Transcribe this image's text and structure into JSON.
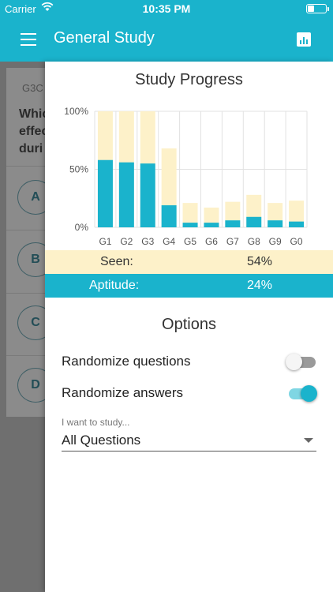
{
  "status_bar": {
    "carrier": "Carrier",
    "time": "10:35 PM"
  },
  "app_bar": {
    "title": "General Study"
  },
  "background_page": {
    "question_id": "G3C",
    "question_text": "Whic\neffec\nduri",
    "options": [
      "A",
      "B",
      "C",
      "D"
    ]
  },
  "drawer": {
    "progress_title": "Study Progress",
    "seen_label": "Seen:",
    "seen_value": "54%",
    "aptitude_label": "Aptitude:",
    "aptitude_value": "24%",
    "options_title": "Options",
    "randomize_questions_label": "Randomize questions",
    "randomize_questions_on": false,
    "randomize_answers_label": "Randomize answers",
    "randomize_answers_on": true,
    "study_label": "I want to study...",
    "study_value": "All Questions"
  },
  "colors": {
    "teal": "#1ab3cc",
    "cream": "#fdf1c9",
    "grid": "#e2e2e2"
  },
  "chart_data": {
    "type": "bar",
    "categories": [
      "G1",
      "G2",
      "G3",
      "G4",
      "G5",
      "G6",
      "G7",
      "G8",
      "G9",
      "G0"
    ],
    "series": [
      {
        "name": "Seen",
        "values": [
          100,
          100,
          100,
          68,
          21,
          17,
          22,
          28,
          21,
          23
        ]
      },
      {
        "name": "Aptitude",
        "values": [
          58,
          56,
          55,
          19,
          4,
          4,
          6,
          9,
          6,
          5
        ]
      }
    ],
    "ylim": [
      0,
      100
    ],
    "yticks": [
      "0%",
      "50%",
      "100%"
    ],
    "grid": true
  }
}
